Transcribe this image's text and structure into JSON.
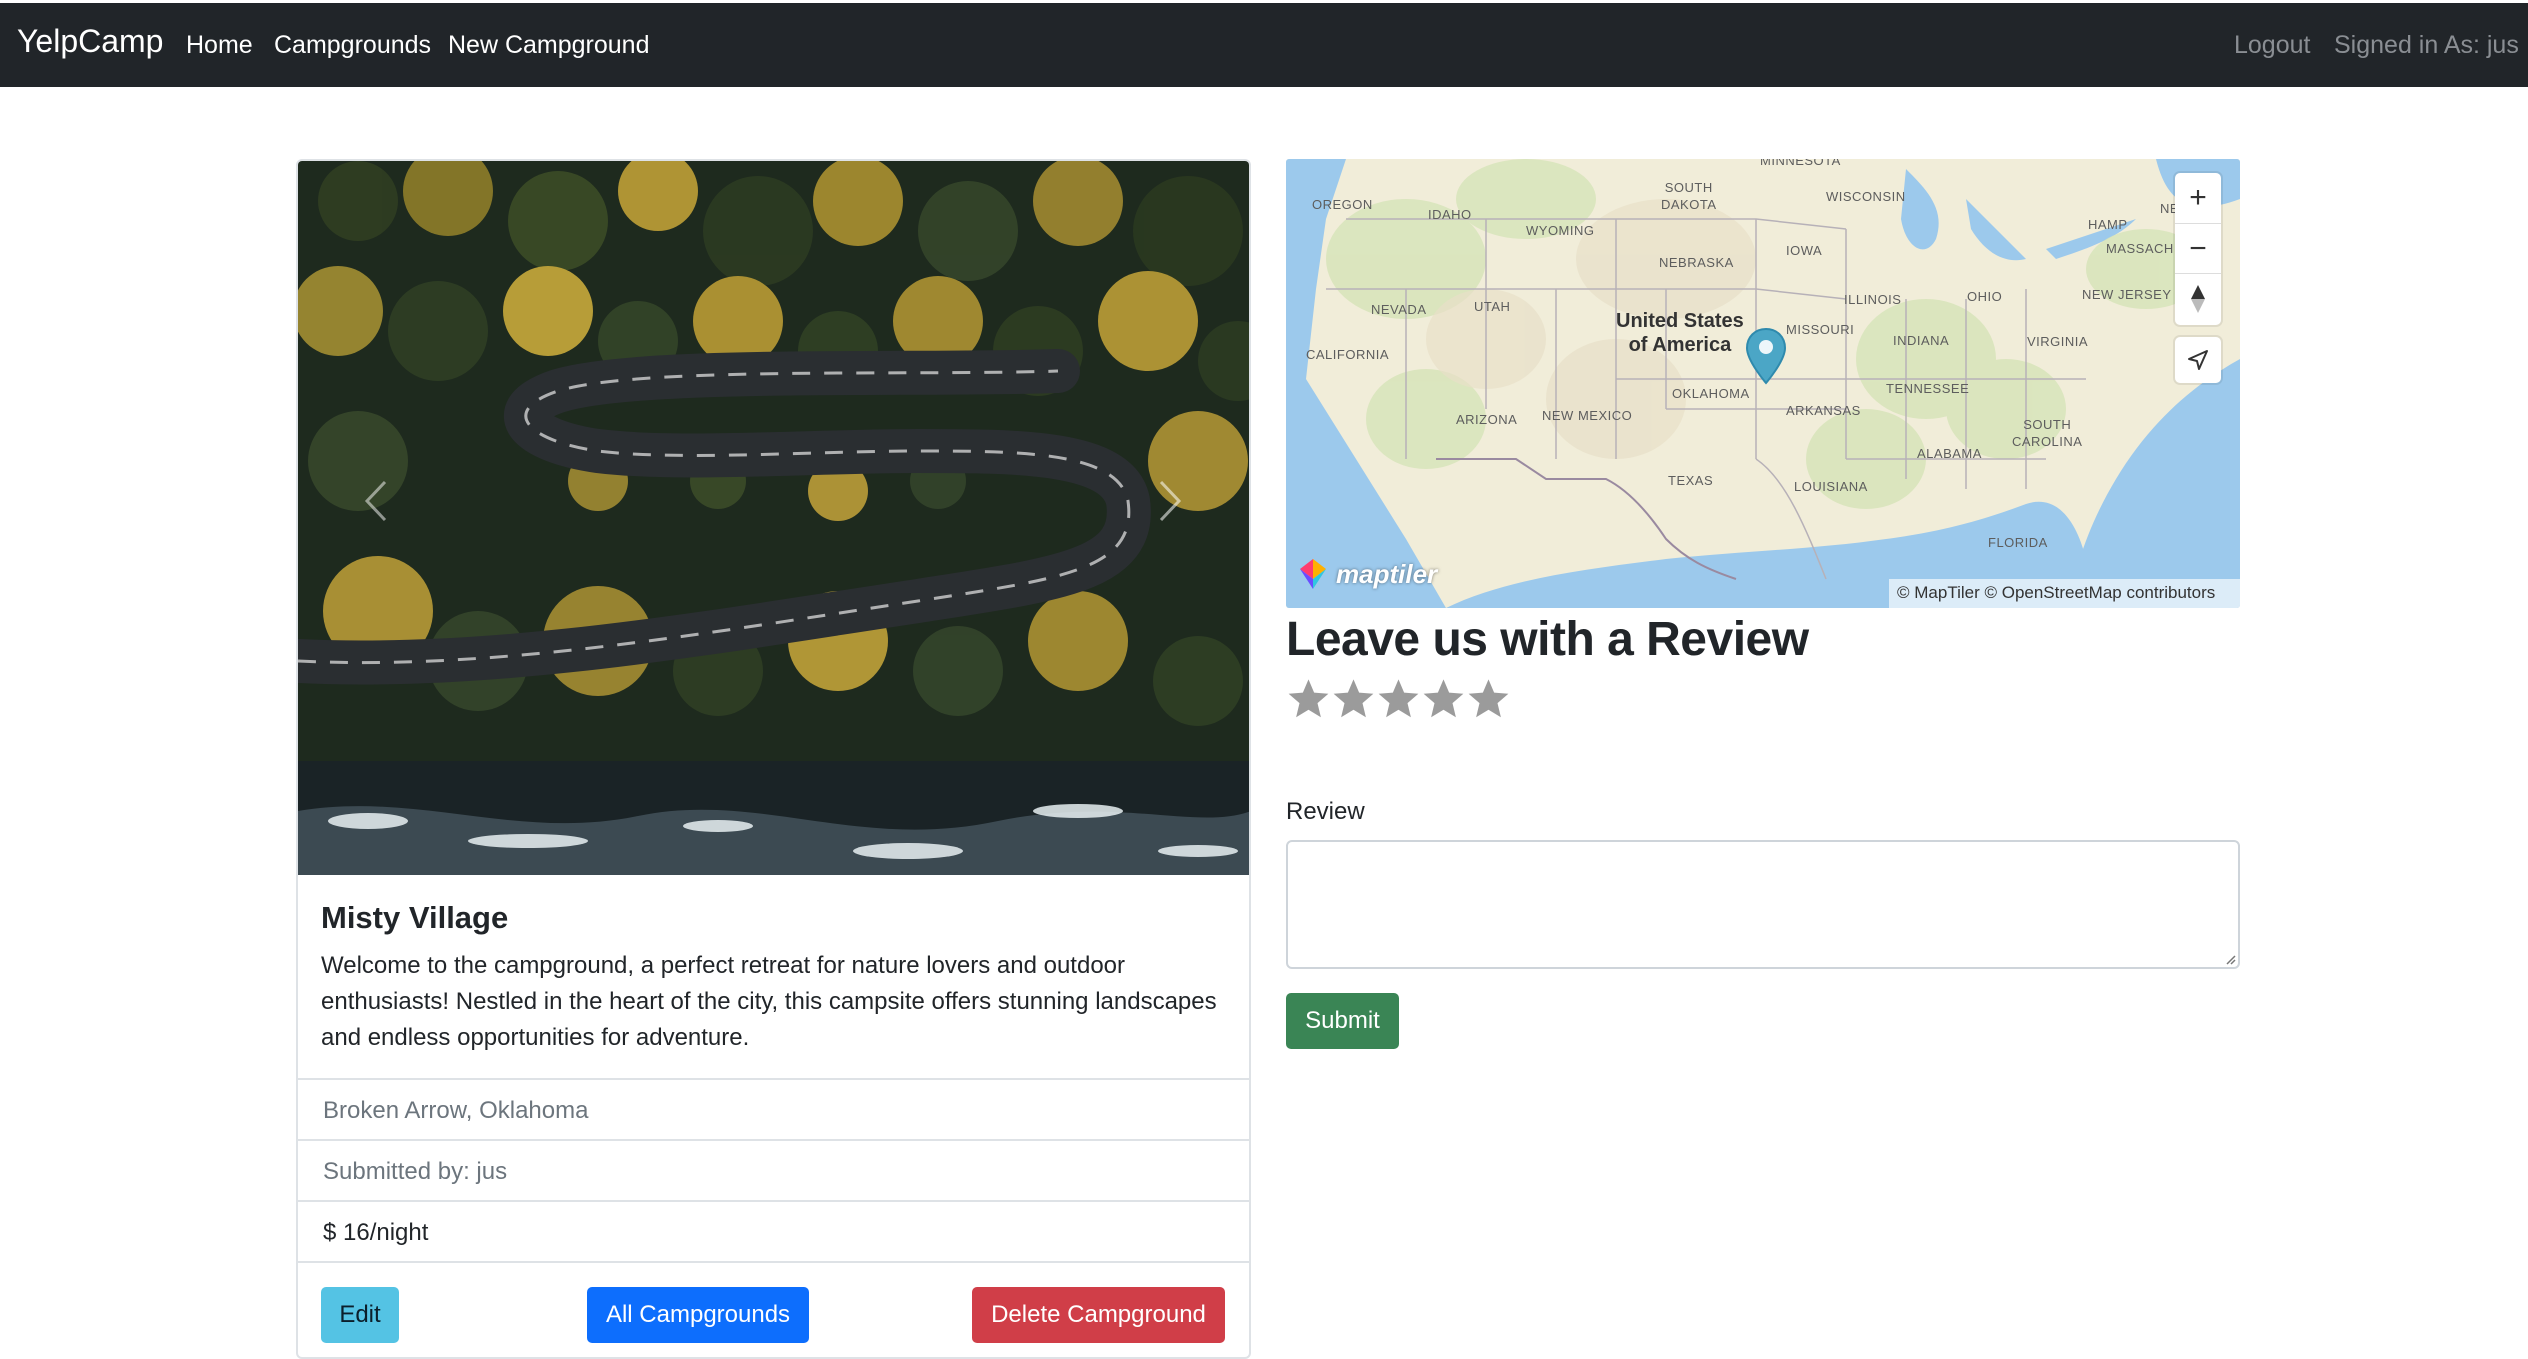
{
  "navbar": {
    "brand": "YelpCamp",
    "links": [
      "Home",
      "Campgrounds",
      "New Campground"
    ],
    "logout": "Logout",
    "signed_in": "Signed in As: jus",
    "colors": {
      "background": "#212529",
      "link": "#ffffff",
      "muted": "#8a8e93"
    }
  },
  "campground": {
    "title": "Misty Village",
    "description": "Welcome to the campground, a perfect retreat for nature lovers and outdoor enthusiasts! Nestled in the heart of the city, this campsite offers stunning landscapes and endless opportunities for adventure.",
    "location": "Broken Arrow, Oklahoma",
    "submitted_by": "Submitted by: jus",
    "price": "$ 16/night",
    "carousel": {
      "prev_icon": "chevron-left-icon",
      "next_icon": "chevron-right-icon"
    }
  },
  "actions": {
    "edit": "Edit",
    "all_campgrounds": "All Campgrounds",
    "delete": "Delete Campground",
    "colors": {
      "edit": "#54c3e4",
      "all": "#0d6efd",
      "delete": "#d03e48"
    }
  },
  "map": {
    "labels": {
      "oregon": "OREGON",
      "idaho": "IDAHO",
      "wyoming": "WYOMING",
      "south_dakota": "SOUTH\nDAKOTA",
      "wisconsin": "WISCONSIN",
      "nebraska": "NEBRASKA",
      "iowa": "IOWA",
      "nevada": "NEVADA",
      "utah": "UTAH",
      "illinois": "ILLINOIS",
      "ohio": "OHIO",
      "new_jersey": "NEW JERSEY",
      "california": "CALIFORNIA",
      "missouri": "MISSOURI",
      "indiana": "INDIANA",
      "virginia": "VIRGINIA",
      "oklahoma": "OKLAHOMA",
      "tennessee": "TENNESSEE",
      "arizona": "ARIZONA",
      "new_mexico": "NEW MEXICO",
      "arkansas": "ARKANSAS",
      "south_carolina": "SOUTH\nCAROLINA",
      "alabama": "ALABAMA",
      "texas": "TEXAS",
      "louisiana": "LOUISIANA",
      "florida": "FLORIDA",
      "massach": "MASSACH",
      "hamp": "HAMP",
      "ne": "NE",
      "minnesota": "MINNESOTA",
      "country": "United States\nof America"
    },
    "controls": {
      "zoom_in": "+",
      "zoom_out": "−"
    },
    "attribution": "© MapTiler © OpenStreetMap contributors",
    "logo": "maptiler",
    "marker_icon": "map-pin-icon"
  },
  "review": {
    "heading": "Leave us with a Review",
    "rating": {
      "max": 5,
      "value": 0
    },
    "label": "Review",
    "textarea_value": "",
    "submit": "Submit",
    "submit_color": "#3a8555"
  }
}
